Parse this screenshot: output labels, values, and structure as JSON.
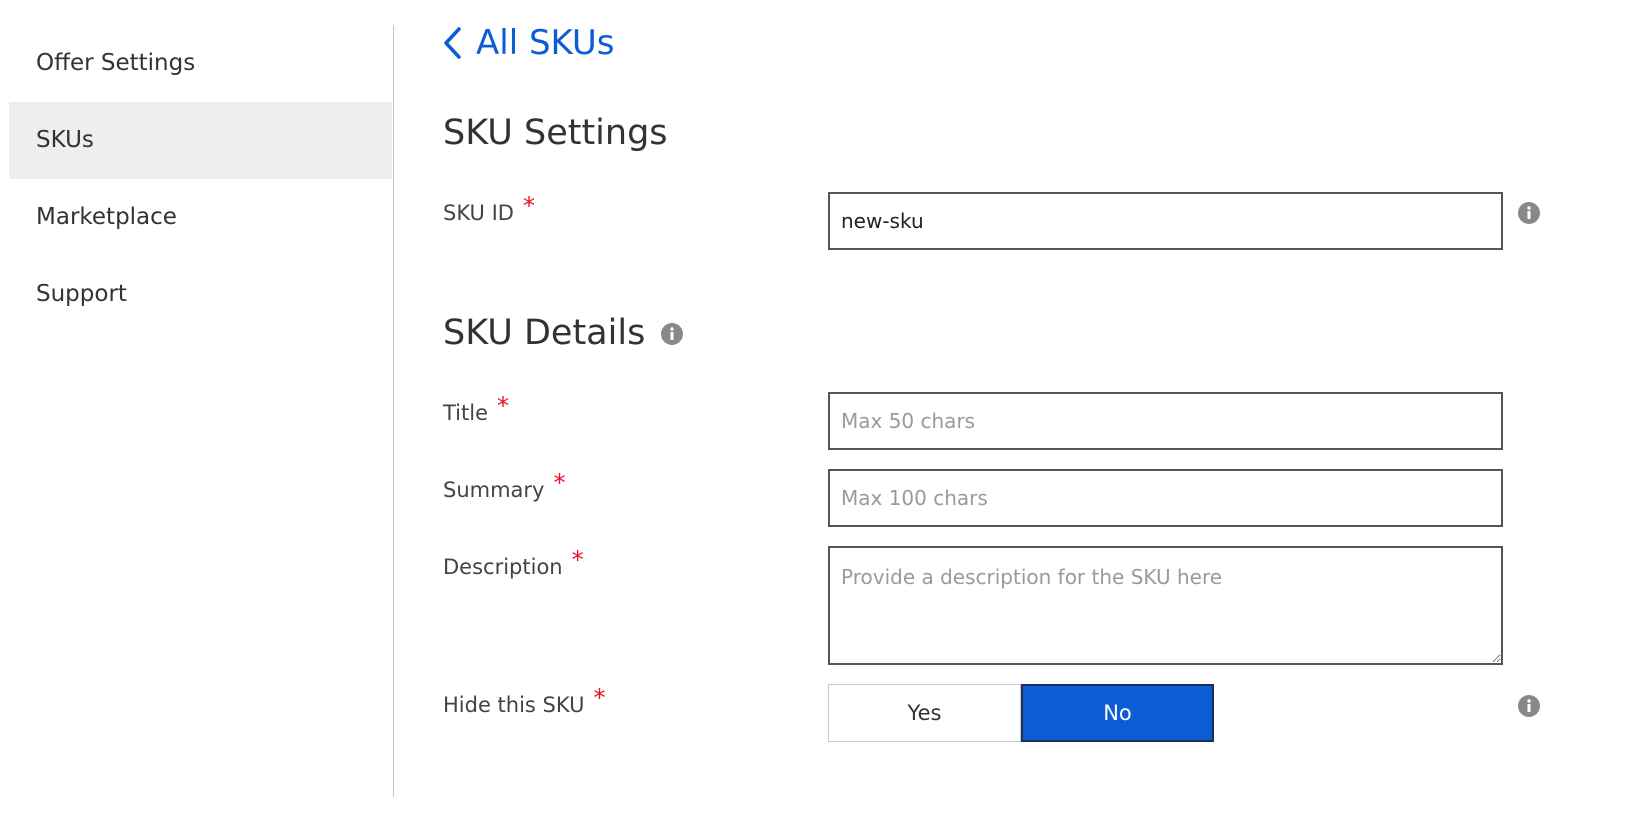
{
  "sidebar": {
    "items": [
      {
        "label": "Offer Settings",
        "active": false
      },
      {
        "label": "SKUs",
        "active": true
      },
      {
        "label": "Marketplace",
        "active": false
      },
      {
        "label": "Support",
        "active": false
      }
    ]
  },
  "back_link": {
    "label": "All SKUs",
    "icon": "chevron-left-icon"
  },
  "sku_settings": {
    "title": "SKU Settings",
    "sku_id": {
      "label": "SKU ID",
      "required": "*",
      "value": "new-sku"
    }
  },
  "sku_details": {
    "title": "SKU Details",
    "title_field": {
      "label": "Title",
      "required": "*",
      "placeholder": "Max 50 chars",
      "value": ""
    },
    "summary_field": {
      "label": "Summary",
      "required": "*",
      "placeholder": "Max 100 chars",
      "value": ""
    },
    "description_field": {
      "label": "Description",
      "required": "*",
      "placeholder": "Provide a description for the SKU here",
      "value": ""
    },
    "hide_sku": {
      "label": "Hide this SKU",
      "required": "*",
      "options": [
        "Yes",
        "No"
      ],
      "selected": "No"
    }
  },
  "colors": {
    "accent": "#0b5cd5",
    "required": "#e81123",
    "sidebar_active_bg": "#eeeeee"
  }
}
